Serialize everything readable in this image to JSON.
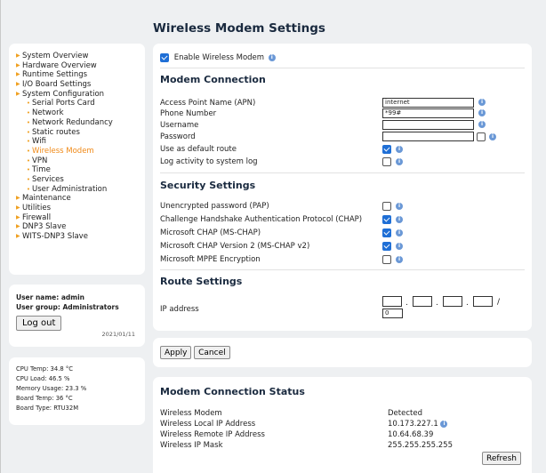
{
  "page": {
    "title": "Wireless Modem Settings"
  },
  "sidebar": {
    "items": [
      {
        "label": "System Overview",
        "level": 0,
        "active": false
      },
      {
        "label": "Hardware Overview",
        "level": 0,
        "active": false
      },
      {
        "label": "Runtime Settings",
        "level": 0,
        "active": false
      },
      {
        "label": "I/O Board Settings",
        "level": 0,
        "active": false
      },
      {
        "label": "System Configuration",
        "level": 0,
        "active": false
      },
      {
        "label": "Serial Ports Card",
        "level": 1,
        "active": false
      },
      {
        "label": "Network",
        "level": 1,
        "active": false
      },
      {
        "label": "Network Redundancy",
        "level": 1,
        "active": false
      },
      {
        "label": "Static routes",
        "level": 1,
        "active": false
      },
      {
        "label": "Wifi",
        "level": 1,
        "active": false
      },
      {
        "label": "Wireless Modem",
        "level": 1,
        "active": true
      },
      {
        "label": "VPN",
        "level": 1,
        "active": false
      },
      {
        "label": "Time",
        "level": 1,
        "active": false
      },
      {
        "label": "Services",
        "level": 1,
        "active": false
      },
      {
        "label": "User Administration",
        "level": 1,
        "active": false
      },
      {
        "label": "Maintenance",
        "level": 0,
        "active": false
      },
      {
        "label": "Utilities",
        "level": 0,
        "active": false
      },
      {
        "label": "Firewall",
        "level": 0,
        "active": false
      },
      {
        "label": "DNP3 Slave",
        "level": 0,
        "active": false
      },
      {
        "label": "WITS-DNP3 Slave",
        "level": 0,
        "active": false
      }
    ]
  },
  "user": {
    "name_line": "User name: admin",
    "group_line": "User group: Administrators",
    "logout_label": "Log out",
    "date": "2021/01/11"
  },
  "stats": {
    "lines": [
      "CPU Temp: 34.8 °C",
      "CPU Load: 46.5 %",
      "Memory Usage: 23.3 %",
      "Board Temp: 36 °C",
      "Board Type: RTU32M"
    ]
  },
  "main": {
    "enable_label": "Enable Wireless Modem",
    "enable_checked": true,
    "connection": {
      "title": "Modem Connection",
      "apn_label": "Access Point Name (APN)",
      "apn_value": "internet",
      "phone_label": "Phone Number",
      "phone_value": "*99#",
      "username_label": "Username",
      "username_value": "",
      "password_label": "Password",
      "password_value": "",
      "default_route_label": "Use as default route",
      "default_route_checked": true,
      "log_label": "Log activity to system log",
      "log_checked": false
    },
    "security": {
      "title": "Security Settings",
      "pap_label": "Unencrypted password (PAP)",
      "pap_checked": false,
      "chap_label": "Challenge Handshake Authentication Protocol (CHAP)",
      "chap_checked": true,
      "mschap_label": "Microsoft CHAP (MS-CHAP)",
      "mschap_checked": true,
      "mschap2_label": "Microsoft CHAP Version 2 (MS-CHAP v2)",
      "mschap2_checked": true,
      "mppe_label": "Microsoft MPPE Encryption",
      "mppe_checked": false
    },
    "route": {
      "title": "Route Settings",
      "ip_label": "IP address",
      "ip_octets": [
        "",
        "",
        "",
        ""
      ],
      "mask_value": "0",
      "separator": ".",
      "slash": "/"
    }
  },
  "actions": {
    "apply_label": "Apply",
    "cancel_label": "Cancel"
  },
  "status": {
    "title": "Modem Connection Status",
    "rows": [
      {
        "label": "Wireless Modem",
        "value": "Detected"
      },
      {
        "label": "Wireless Local IP Address",
        "value": "10.173.227.1"
      },
      {
        "label": "Wireless Remote IP Address",
        "value": "10.64.68.39"
      },
      {
        "label": "Wireless IP Mask",
        "value": "255.255.255.255"
      }
    ],
    "refresh_label": "Refresh"
  },
  "colors": {
    "accent": "#f08a18",
    "checkbox": "#1f6fd6",
    "info": "#6a98d6",
    "title": "#1a2a3f"
  }
}
